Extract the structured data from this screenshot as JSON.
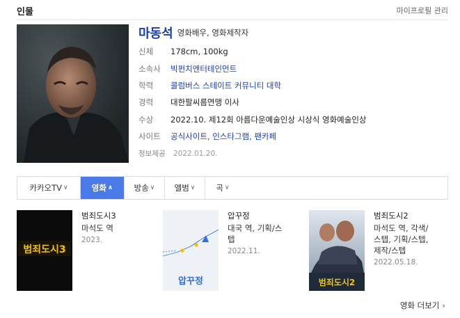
{
  "section": {
    "title": "인물",
    "manage_label": "마이프로필 관리"
  },
  "person": {
    "name": "마동석",
    "occupation": "영화배우, 영화제작자",
    "info": {
      "body": {
        "label": "신체",
        "value": "178cm, 100kg"
      },
      "agency": {
        "label": "소속사",
        "value": "빅펀치엔터테인먼트"
      },
      "education": {
        "label": "학력",
        "value": "콜럼버스 스테이트 커뮤니티 대학"
      },
      "career": {
        "label": "경력",
        "value": "대한팔씨름연맹 이사"
      },
      "award": {
        "label": "수상",
        "value": "2022.10. 제12회 아름다운예술인상 시상식 영화예술인상"
      },
      "sites": {
        "label": "사이트",
        "official": "공식사이트",
        "instagram": "인스타그램",
        "fancafe": "팬카페",
        "separator": ", "
      },
      "source": {
        "label": "정보제공",
        "value": "2022.01.20."
      }
    }
  },
  "tabs": [
    {
      "label": "카카오TV",
      "chevron": "∨",
      "active": false
    },
    {
      "label": "영화",
      "chevron": "∧",
      "active": true
    },
    {
      "label": "방송",
      "chevron": "∨",
      "active": false
    },
    {
      "label": "앨범",
      "chevron": "∨",
      "active": false
    },
    {
      "label": "곡",
      "chevron": "∨",
      "active": false
    }
  ],
  "movies": [
    {
      "title": "범죄도시3",
      "role": "마석도 역",
      "date": "2023.",
      "poster_text": "범죄도시3",
      "poster_color": "#0b0b0b"
    },
    {
      "title": "압꾸정",
      "role": "대국 역, 기획/스\n텝",
      "date": "2022.11.",
      "poster_text": "압꾸정",
      "poster_color": "#eef2f6"
    },
    {
      "title": "범죄도시2",
      "role": "마석도 역, 각색/\n스텝, 기획/스텝,\n제작/스텝",
      "date": "2022.05.18.",
      "poster_text": "범죄도시2",
      "poster_color": "#1e2a3a"
    }
  ],
  "more": {
    "label": "영화 더보기",
    "arrow": "›"
  },
  "colors": {
    "link": "#1a3eaa",
    "active_tab": "#4a7ae8",
    "poster_title_yellow": "#f2c200"
  },
  "icons": {
    "chevron_down": "chevron-down-icon",
    "chevron_up": "chevron-up-icon",
    "arrow_right": "chevron-right-icon"
  }
}
